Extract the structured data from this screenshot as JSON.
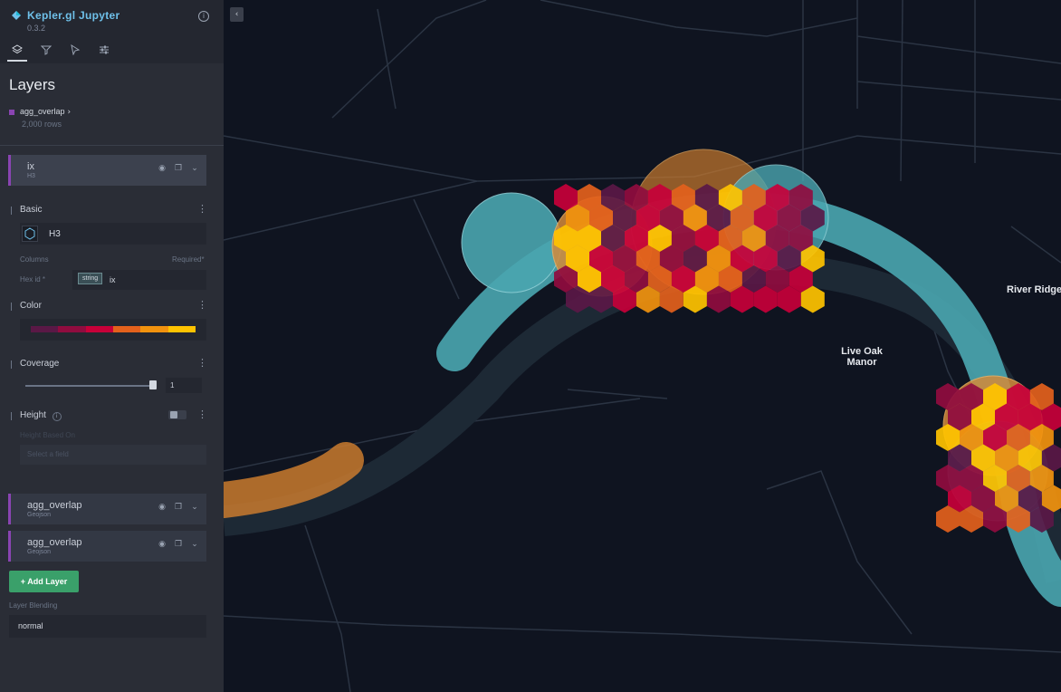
{
  "app": {
    "title": "Kepler.gl Jupyter",
    "version": "0.3.2"
  },
  "tabs": [
    "layers",
    "filters",
    "interactions",
    "map-style"
  ],
  "panel": {
    "title": "Layers"
  },
  "dataset": {
    "name": "agg_overlap",
    "rows": "2,000 rows",
    "color": "#8a44b2"
  },
  "layers": [
    {
      "name": "ix",
      "type": "H3",
      "active": true
    },
    {
      "name": "agg_overlap",
      "type": "Geojson",
      "active": false
    },
    {
      "name": "agg_overlap",
      "type": "Geojson",
      "active": false
    }
  ],
  "config": {
    "basic_label": "Basic",
    "layer_type": "H3",
    "columns_label": "Columns",
    "required_label": "Required*",
    "hexid_label": "Hex id *",
    "hexid_type": "string",
    "hexid_value": "ix",
    "color_label": "Color",
    "color_ramp": [
      "#5a1846",
      "#900c3f",
      "#c70039",
      "#e3611c",
      "#f1920e",
      "#ffc300"
    ],
    "coverage_label": "Coverage",
    "coverage_value": "1",
    "coverage_fraction": 1,
    "height_label": "Height",
    "height_based_label": "Height Based On",
    "height_placeholder": "Select a field"
  },
  "add_layer_label": "Add Layer",
  "blending": {
    "label": "Layer Blending",
    "value": "normal"
  },
  "map": {
    "labels": {
      "live_oak": "Live Oak\nManor",
      "river_ridge": "River Ridge"
    }
  }
}
